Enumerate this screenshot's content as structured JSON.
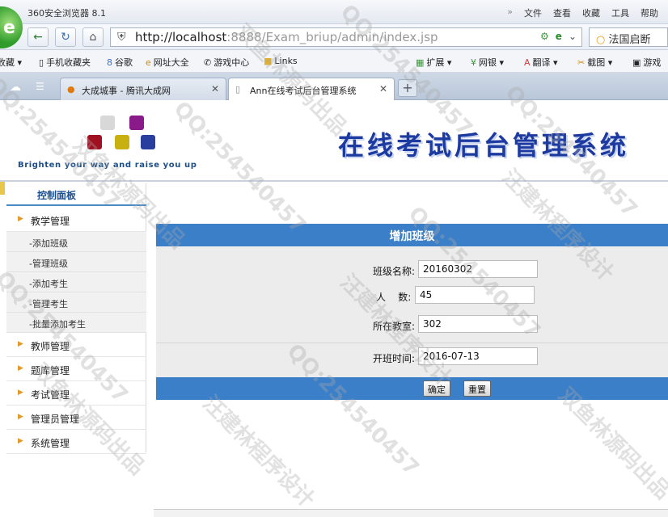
{
  "browser": {
    "title": "360安全浏览器 8.1",
    "menu": [
      "文件",
      "查看",
      "收藏",
      "工具",
      "帮助"
    ],
    "url_host": "http://localhost",
    "url_rest": ":8888/Exam_briup/admin/index.jsp",
    "search_text": "法国启断",
    "bookmarks": [
      "收藏",
      "手机收藏夹",
      "谷歌",
      "网址大全",
      "游戏中心",
      "Links"
    ],
    "bookmarks_right": [
      "扩展",
      "网银",
      "翻译",
      "截图",
      "游戏"
    ],
    "tabs": [
      {
        "label": "大成城事 - 腾讯大成网",
        "active": false
      },
      {
        "label": "Ann在线考试后台管理系统",
        "active": true
      }
    ]
  },
  "banner": {
    "slogan": "Brighten your way and raise you up",
    "title": "在线考试后台管理系统"
  },
  "sidebar": {
    "panel_title": "控制面板",
    "groups": [
      {
        "label": "教学管理",
        "items": [
          "添加班级",
          "管理班级",
          "添加考生",
          "管理考生",
          "批量添加考生"
        ]
      },
      {
        "label": "教师管理"
      },
      {
        "label": "题库管理"
      },
      {
        "label": "考试管理"
      },
      {
        "label": "管理员管理"
      },
      {
        "label": "系统管理"
      }
    ]
  },
  "form": {
    "title": "增加班级",
    "fields": {
      "class_name": {
        "label": "班级名称:",
        "value": "20160302"
      },
      "people": {
        "label": "人    数:",
        "value": "45"
      },
      "classroom": {
        "label": "所在教室:",
        "value": "302"
      },
      "start_time": {
        "label": "开班时间:",
        "value": "2016-07-13"
      }
    },
    "confirm_label": "确定",
    "reset_label": "重置"
  },
  "watermarks": [
    "QQ:254540457",
    "汪建林程序设计",
    "双鱼林源码出品"
  ]
}
